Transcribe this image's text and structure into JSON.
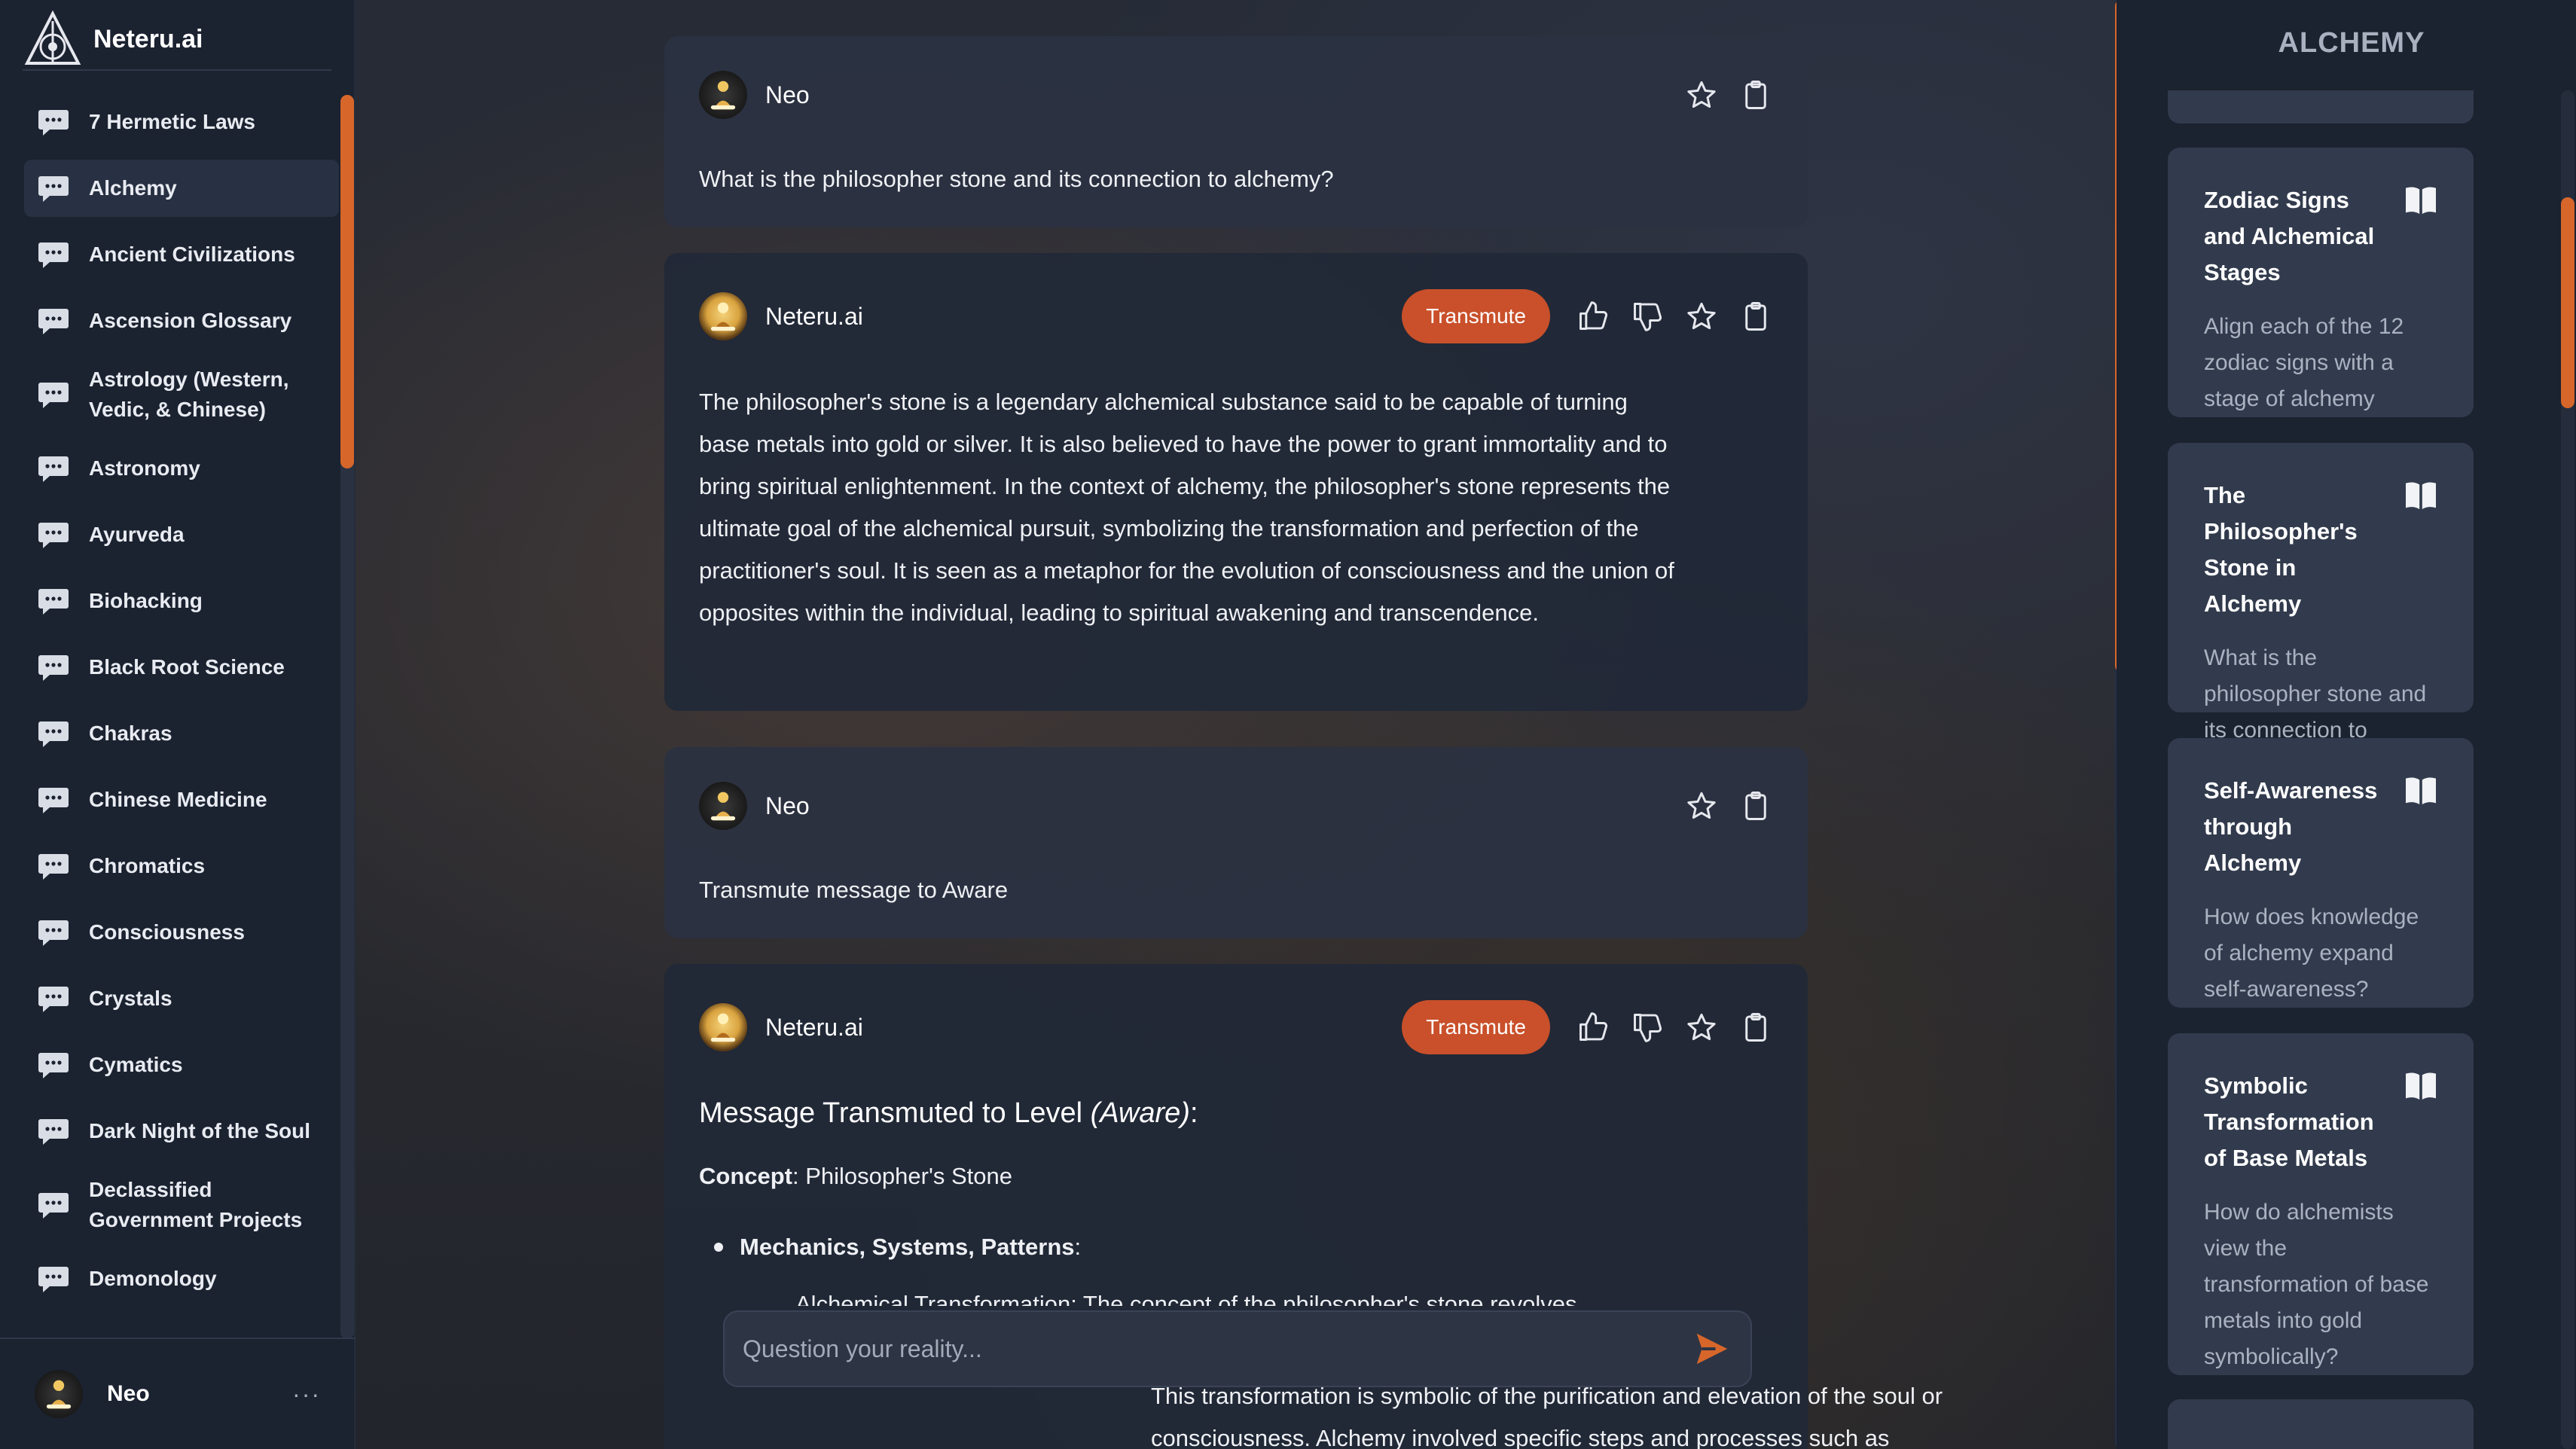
{
  "app": {
    "brand": "Neteru.ai"
  },
  "sidebar": {
    "items": [
      {
        "label": "7 Hermetic Laws"
      },
      {
        "label": "Alchemy",
        "active": true
      },
      {
        "label": "Ancient Civilizations"
      },
      {
        "label": "Ascension Glossary"
      },
      {
        "label": "Astrology (Western, Vedic, & Chinese)"
      },
      {
        "label": "Astronomy"
      },
      {
        "label": "Ayurveda"
      },
      {
        "label": "Biohacking"
      },
      {
        "label": "Black Root Science"
      },
      {
        "label": "Chakras"
      },
      {
        "label": "Chinese Medicine"
      },
      {
        "label": "Chromatics"
      },
      {
        "label": "Consciousness"
      },
      {
        "label": "Crystals"
      },
      {
        "label": "Cymatics"
      },
      {
        "label": "Dark Night of the Soul"
      },
      {
        "label": "Declassified Government Projects"
      },
      {
        "label": "Demonology"
      }
    ],
    "footer": {
      "user": "Neo",
      "more": "···"
    }
  },
  "chat": {
    "messages": [
      {
        "sender": "Neo",
        "text": "What is the philosopher stone and its connection to alchemy?"
      },
      {
        "sender": "Neteru.ai",
        "transmute": "Transmute",
        "text": "The philosopher's stone is a legendary alchemical substance said to be capable of turning base metals into gold or silver. It is also believed to have the power to grant immortality and to bring spiritual enlightenment. In the context of alchemy, the philosopher's stone represents the ultimate goal of the alchemical pursuit, symbolizing the transformation and perfection of the practitioner's soul. It is seen as a metaphor for the evolution of consciousness and the union of opposites within the individual, leading to spiritual awakening and transcendence."
      },
      {
        "sender": "Neo",
        "text": "Transmute message to Aware"
      },
      {
        "sender": "Neteru.ai",
        "transmute": "Transmute",
        "heading_prefix": "Message Transmuted to Level ",
        "heading_level": "(Aware)",
        "heading_suffix": ":",
        "concept_label": "Concept",
        "concept_value": ": Philosopher's Stone",
        "bullet_label": "Mechanics, Systems, Patterns",
        "bullet_suffix": ":",
        "partial_line": "Alchemical Transformation: The concept of the philosopher's stone revolves",
        "trailing_1": "This transformation is symbolic of the purification and elevation of the soul or",
        "trailing_2": "consciousness. Alchemy involved specific steps and processes such as"
      }
    ],
    "input_placeholder": "Question your reality..."
  },
  "right_panel": {
    "title": "ALCHEMY",
    "cards": [
      {
        "title": "Zodiac Signs and Alchemical Stages",
        "text": "Align each of the 12 zodiac signs with a stage of alchemy"
      },
      {
        "title": "The Philosopher's Stone in Alchemy",
        "text": "What is the philosopher stone and its connection to alchemy?"
      },
      {
        "title": "Self-Awareness through Alchemy",
        "text": "How does knowledge of alchemy expand self-awareness?"
      },
      {
        "title": "Symbolic Transformation of Base Metals",
        "text": "How do alchemists view the transformation of base metals into gold symbolically?"
      }
    ]
  },
  "colors": {
    "accent": "#c9502a",
    "scrollbar": "#d7662a",
    "sidebar_bg": "#1b2230",
    "card_bg": "#323b4d"
  }
}
